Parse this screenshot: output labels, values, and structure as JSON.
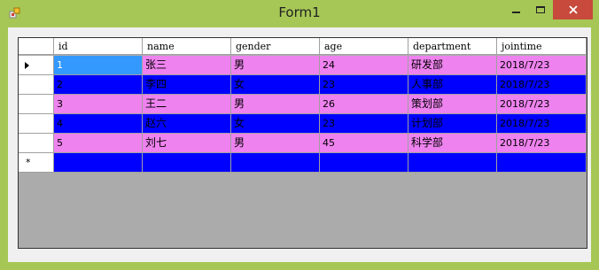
{
  "window": {
    "title": "Form1"
  },
  "grid": {
    "columns": [
      "id",
      "name",
      "gender",
      "age",
      "department",
      "jointime"
    ],
    "rows": [
      [
        "1",
        "张三",
        "男",
        "24",
        "研发部",
        "2018/7/23"
      ],
      [
        "2",
        "李四",
        "女",
        "23",
        "人事部",
        "2018/7/23"
      ],
      [
        "3",
        "王二",
        "男",
        "26",
        "策划部",
        "2018/7/23"
      ],
      [
        "4",
        "赵六",
        "女",
        "23",
        "计划部",
        "2018/7/23"
      ],
      [
        "5",
        "刘七",
        "男",
        "45",
        "科学部",
        "2018/7/23"
      ]
    ],
    "new_row_marker": "*"
  },
  "colors": {
    "title_bar": "#a6c756",
    "row_odd": "#ee82ee",
    "row_even": "#0000ff",
    "selected_cell": "#3399ff",
    "grid_background": "#ababab",
    "close_button": "#c74a3c"
  },
  "icons": {
    "app": "app-icon",
    "minimize": "minimize-icon",
    "maximize": "maximize-icon",
    "close": "close-icon",
    "current_row": "row-pointer-icon"
  }
}
